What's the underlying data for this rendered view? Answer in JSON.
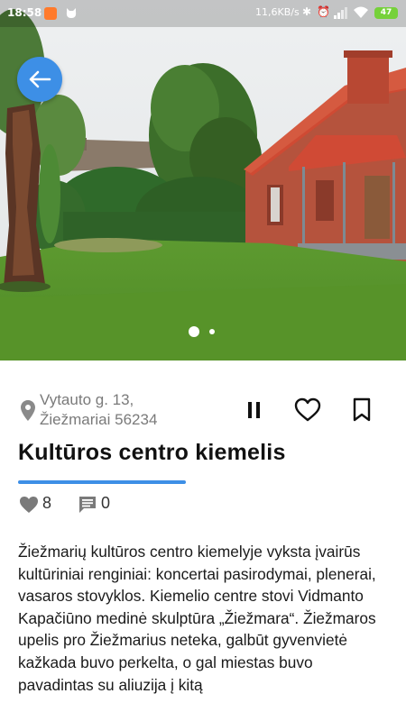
{
  "status_bar": {
    "time": "18:58",
    "network_speed": "11,6KB/s",
    "battery": "47"
  },
  "icons": {
    "back": "arrow-left-icon",
    "location": "location-pin-icon",
    "pause": "pause-icon",
    "favorite": "heart-outline-icon",
    "bookmark": "bookmark-outline-icon",
    "likes": "heart-filled-icon",
    "comments": "comment-icon"
  },
  "place": {
    "address_line1": "Vytauto g. 13,",
    "address_line2": "Žiežmariai 56234",
    "title": "Kultūros centro kiemelis",
    "likes": "8",
    "comments": "0",
    "description": "Žiežmarių kultūros centro kiemelyje vyksta įvairūs kultūriniai renginiai: koncertai pasirodymai, plenerai, vasaros stovyklos. Kiemelio centre stovi Vidmanto Kapačiūno medinė skulptūra „Žiežmara“. Žiežmaros upelis pro Žiežmarius neteka, galbūt gyvenvietė kažkada buvo perkelta, o gal miestas buvo pavadintas su aliuzija į kitą"
  },
  "gallery": {
    "image_count": 2,
    "active_index": 1
  },
  "colors": {
    "accent": "#3d8fe6",
    "underline": "#3d8fe6",
    "battery": "#76d13a"
  }
}
